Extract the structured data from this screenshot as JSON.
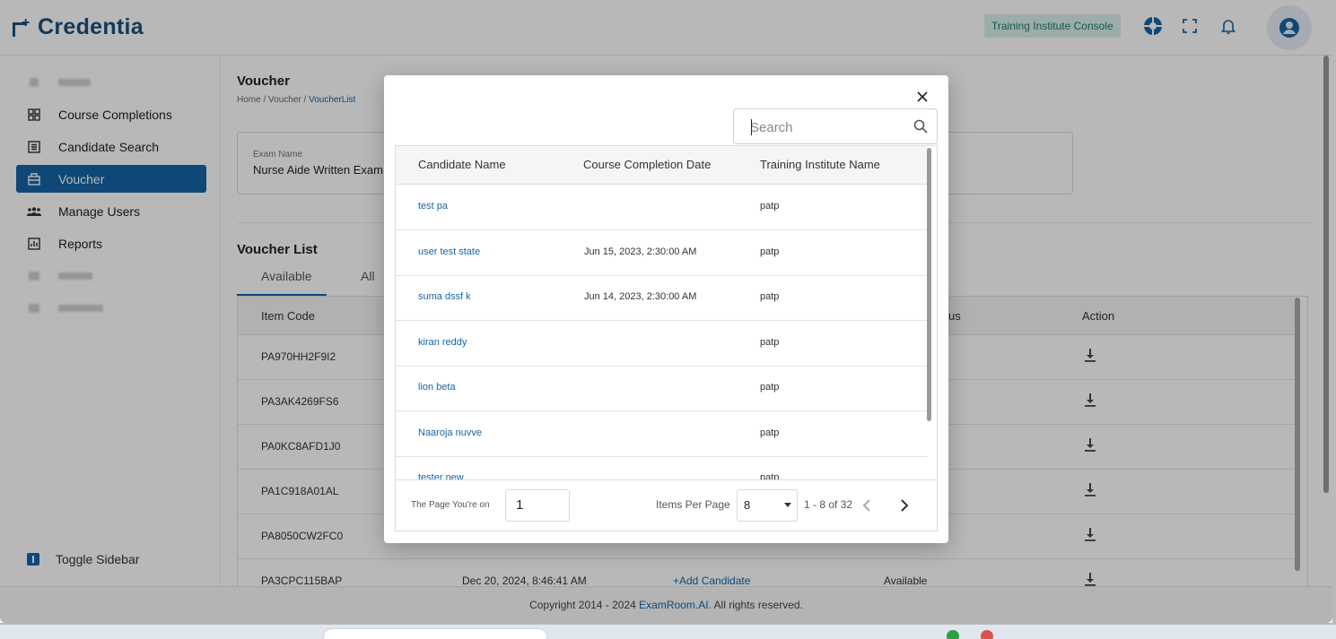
{
  "header": {
    "logo_text": "Credentia",
    "console_badge": "Training Institute Console"
  },
  "sidebar": {
    "items": [
      {
        "label": "Course Completions",
        "icon": "grid-icon"
      },
      {
        "label": "Candidate Search",
        "icon": "list-icon"
      },
      {
        "label": "Voucher",
        "icon": "voucher-icon",
        "active": true
      },
      {
        "label": "Manage Users",
        "icon": "users-icon"
      },
      {
        "label": "Reports",
        "icon": "chart-icon"
      }
    ],
    "toggle_label": "Toggle Sidebar"
  },
  "main": {
    "page_title": "Voucher",
    "breadcrumbs": [
      "Home",
      "Voucher",
      "VoucherList"
    ],
    "exam_label": "Exam Name",
    "exam_value": "Nurse Aide Written Exam",
    "voucher_list_title": "Voucher List",
    "tabs": [
      "Available",
      "All"
    ],
    "table": {
      "headers": {
        "item_code": "Item Code",
        "status_fragment": "us",
        "action": "Action"
      },
      "rows": [
        {
          "code": "PA970HH2F9I2"
        },
        {
          "code": "PA3AK4269FS6"
        },
        {
          "code": "PA0KC8AFD1J0"
        },
        {
          "code": "PA1C918A01AL"
        },
        {
          "code": "PA8050CW2FC0"
        },
        {
          "code": "PA3CPC115BAP",
          "date": "Dec 20, 2024, 8:46:41 AM",
          "add": "+Add Candidate",
          "status": "Available"
        }
      ]
    }
  },
  "footer": {
    "text": "Copyright 2014 - 2024",
    "brand": "ExamRoom.AI.",
    "rights": "All rights reserved."
  },
  "modal": {
    "search_placeholder": "Search",
    "headers": [
      "Candidate Name",
      "Course Completion Date",
      "Training Institute Name"
    ],
    "rows": [
      {
        "name": "test pa",
        "date": "",
        "institute": "patp"
      },
      {
        "name": "user test state",
        "date": "Jun 15, 2023, 2:30:00 AM",
        "institute": "patp"
      },
      {
        "name": "suma dssf k",
        "date": "Jun 14, 2023, 2:30:00 AM",
        "institute": "patp"
      },
      {
        "name": "kiran reddy",
        "date": "",
        "institute": "patp"
      },
      {
        "name": "lion beta",
        "date": "",
        "institute": "patp"
      },
      {
        "name": "Naaroja nuvve",
        "date": "",
        "institute": "patp"
      },
      {
        "name": "tester new",
        "date": "",
        "institute": "patp"
      }
    ],
    "pager": {
      "page_label": "The Page You're on",
      "page_value": "1",
      "ipp_label": "Items Per Page",
      "ipp_value": "8",
      "range": "1 - 8 of 32"
    }
  }
}
